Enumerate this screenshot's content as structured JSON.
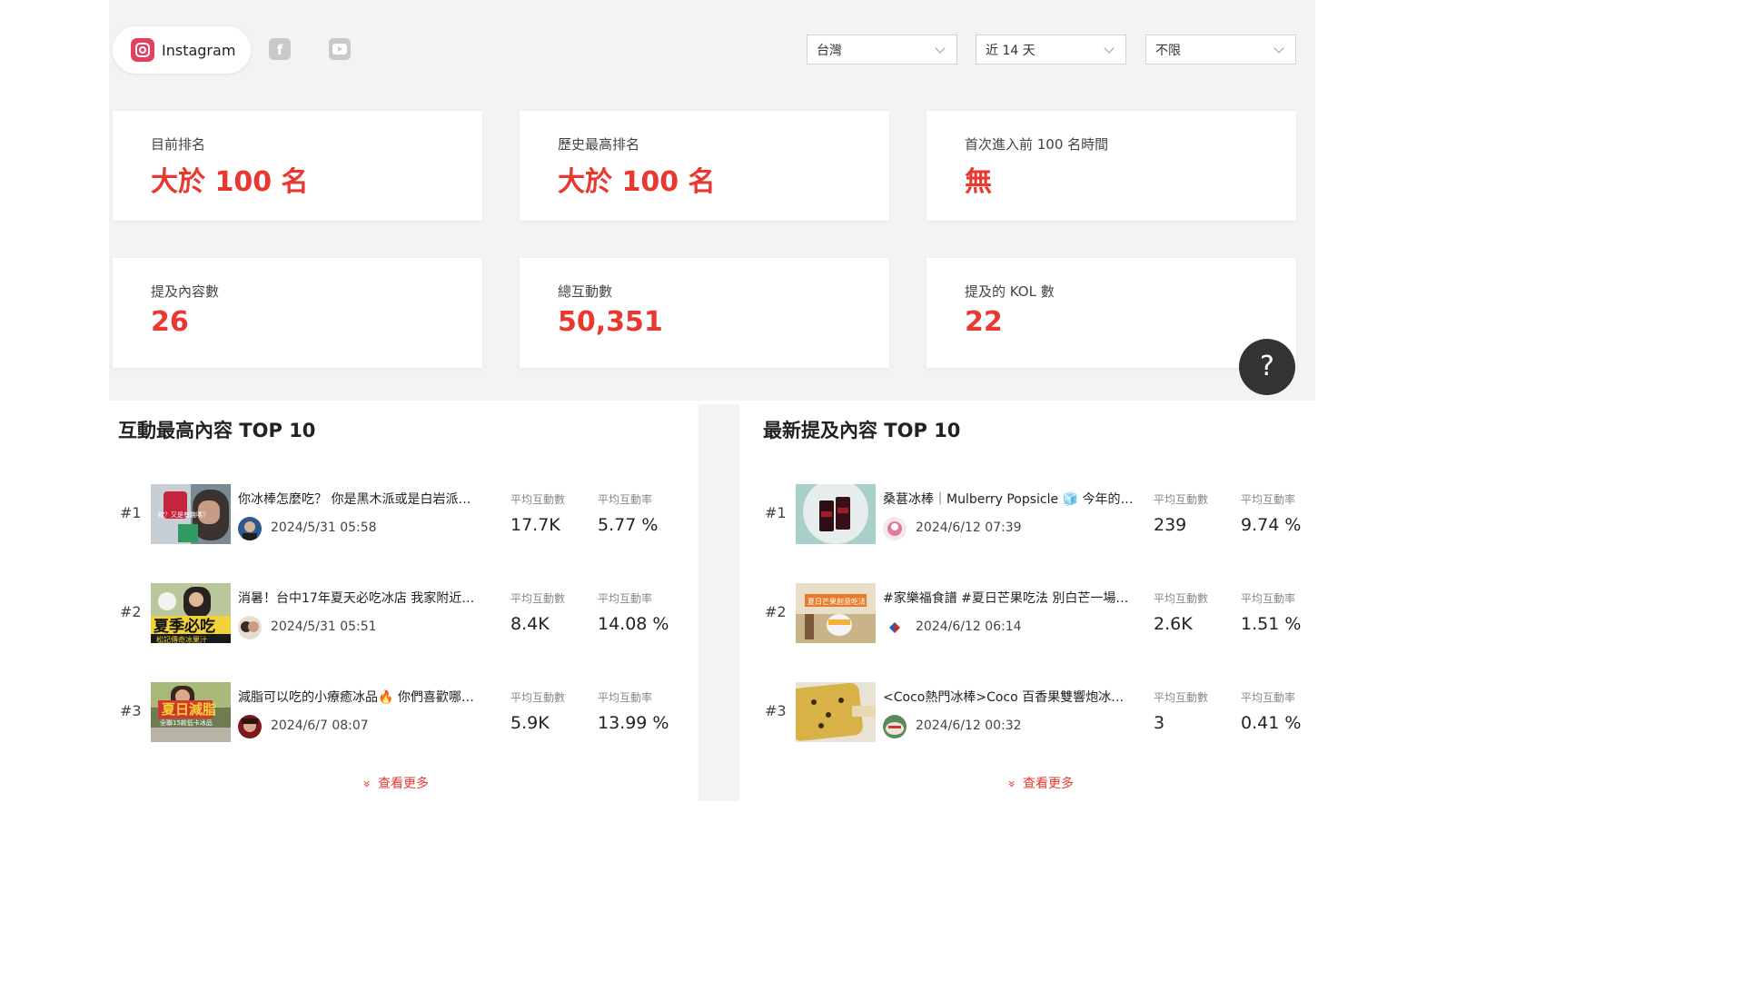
{
  "platforms": {
    "active_label": "Instagram",
    "icons": [
      "instagram-icon",
      "facebook-icon",
      "youtube-icon"
    ],
    "facebook_glyph": "f"
  },
  "filters": {
    "region": "台灣",
    "period": "近 14 天",
    "type": "不限"
  },
  "stats": [
    {
      "label": "目前排名",
      "value": "大於 100 名"
    },
    {
      "label": "歷史最高排名",
      "value": "大於 100 名"
    },
    {
      "label": "首次進入前 100 名時間",
      "value": "無"
    },
    {
      "label": "提及內容數",
      "value": "26"
    },
    {
      "label": "總互動數",
      "value": "50,351"
    },
    {
      "label": "提及的 KOL 數",
      "value": "22"
    }
  ],
  "help": {
    "glyph": "?"
  },
  "colors": {
    "accent": "#e8382f",
    "background_panel": "#f3f3f3"
  },
  "top_engagement": {
    "title": "互動最高內容 TOP 10",
    "metric_labels": [
      "平均互動數",
      "平均互動率"
    ],
    "more_label": "查看更多",
    "items": [
      {
        "rank": "#1",
        "text": "你冰棒怎麼吃？ 你是黑木派或是白岩派…",
        "date": "2024/5/31 05:58",
        "avg_interactions": "17.7K",
        "avg_rate": "5.77 %",
        "thumb_caption": "欸？又是有趣嗎？"
      },
      {
        "rank": "#2",
        "text": "消暑！台中17年夏天必吃冰店 我家附近…",
        "date": "2024/5/31 05:51",
        "avg_interactions": "8.4K",
        "avg_rate": "14.08 %",
        "thumb_caption": "夏季必吃",
        "thumb_subcaption": "松記傳奇冰果汁"
      },
      {
        "rank": "#3",
        "text": "減脂可以吃的小療癒冰品🔥 你們喜歡哪…",
        "date": "2024/6/7 08:07",
        "avg_interactions": "5.9K",
        "avg_rate": "13.99 %",
        "thumb_caption": "夏日減脂",
        "thumb_subcaption": "全聯15款低卡冰品"
      }
    ]
  },
  "latest_mentions": {
    "title": "最新提及內容 TOP 10",
    "metric_labels": [
      "平均互動數",
      "平均互動率"
    ],
    "more_label": "查看更多",
    "items": [
      {
        "rank": "#1",
        "text": "桑葚冰棒｜Mulberry Popsicle 🧊 今年的…",
        "date": "2024/6/12 07:39",
        "avg_interactions": "239",
        "avg_rate": "9.74 %"
      },
      {
        "rank": "#2",
        "text": "#家樂福食譜 #夏日芒果吃法 別白芒一場…",
        "date": "2024/6/12 06:14",
        "avg_interactions": "2.6K",
        "avg_rate": "1.51 %",
        "thumb_caption": "夏日芒果創意吃法"
      },
      {
        "rank": "#3",
        "text": "<Coco熱門冰棒>Coco 百香果雙響炮冰…",
        "date": "2024/6/12 00:32",
        "avg_interactions": "3",
        "avg_rate": "0.41 %"
      }
    ]
  }
}
